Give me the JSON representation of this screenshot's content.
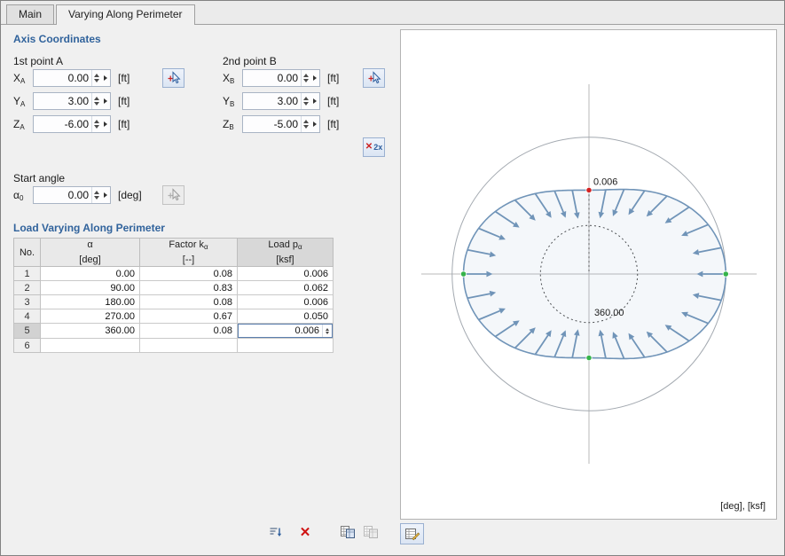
{
  "tabs": {
    "main": "Main",
    "varying": "Varying Along Perimeter"
  },
  "axis": {
    "title": "Axis Coordinates",
    "point_a": {
      "label": "1st point A",
      "rows": [
        {
          "sym": "X",
          "sub": "A",
          "value": "0.00",
          "unit": "[ft]"
        },
        {
          "sym": "Y",
          "sub": "A",
          "value": "3.00",
          "unit": "[ft]"
        },
        {
          "sym": "Z",
          "sub": "A",
          "value": "-6.00",
          "unit": "[ft]"
        }
      ]
    },
    "point_b": {
      "label": "2nd point B",
      "rows": [
        {
          "sym": "X",
          "sub": "B",
          "value": "0.00",
          "unit": "[ft]"
        },
        {
          "sym": "Y",
          "sub": "B",
          "value": "3.00",
          "unit": "[ft]"
        },
        {
          "sym": "Z",
          "sub": "B",
          "value": "-5.00",
          "unit": "[ft]"
        }
      ]
    },
    "start_angle": {
      "label": "Start angle",
      "sym": "α",
      "sub": "0",
      "value": "0.00",
      "unit": "[deg]"
    },
    "pick_2x_label": "2x"
  },
  "load_table": {
    "title": "Load Varying Along Perimeter",
    "headers": [
      {
        "line1": "",
        "sub": "",
        "line2": "No."
      },
      {
        "line1": "α",
        "sub": "",
        "line2": "[deg]"
      },
      {
        "line1": "Factor k",
        "sub": "α",
        "line2": "[--]"
      },
      {
        "line1": "Load p",
        "sub": "α",
        "line2": "[ksf]"
      }
    ],
    "rows": [
      [
        "1",
        "0.00",
        "0.08",
        "0.006"
      ],
      [
        "2",
        "90.00",
        "0.83",
        "0.062"
      ],
      [
        "3",
        "180.00",
        "0.08",
        "0.006"
      ],
      [
        "4",
        "270.00",
        "0.67",
        "0.050"
      ],
      [
        "5",
        "360.00",
        "0.08",
        "0.006"
      ],
      [
        "6",
        "",
        "",
        ""
      ]
    ]
  },
  "icons": {
    "pick": "select-point-cursor-icon",
    "sort": "sort-rows-icon",
    "delete": "delete-all-rows-icon",
    "import": "import-table-icon",
    "export": "export-table-icon",
    "diagram_settings": "edit-diagram-icon"
  },
  "chart_data": {
    "type": "polar-load-diagram",
    "title": "Load varying along perimeter",
    "angle_unit": "[deg]",
    "load_unit": "[ksf]",
    "points": [
      {
        "angle": 0,
        "load": 0.006
      },
      {
        "angle": 90,
        "load": 0.062
      },
      {
        "angle": 180,
        "load": 0.006
      },
      {
        "angle": 270,
        "load": 0.05
      },
      {
        "angle": 360,
        "load": 0.006
      }
    ],
    "labels": {
      "max_value": "0.006",
      "angle_label": "360.00",
      "units_note": "[deg], [ksf]"
    },
    "colors": {
      "curve": "#7094b8",
      "arrow": "#7094b8",
      "marker_max": "#d42222",
      "marker_node": "#35b34a",
      "axis": "#b9b9b9",
      "circle": "#a3a9b0"
    }
  }
}
